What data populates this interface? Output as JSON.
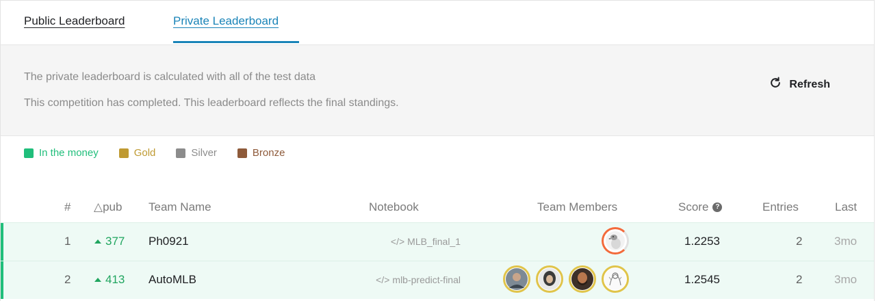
{
  "tabs": {
    "public_label": "Public Leaderboard",
    "private_label": "Private Leaderboard",
    "active": "Private Leaderboard"
  },
  "info": {
    "line1": "The private leaderboard is calculated with all of the test data",
    "line2": "This competition has completed. This leaderboard reflects the final standings.",
    "refresh_label": "Refresh"
  },
  "legend": {
    "items": [
      {
        "label": "In the money",
        "color": "#20be7b"
      },
      {
        "label": "Gold",
        "color": "#bf9a32"
      },
      {
        "label": "Silver",
        "color": "#8c8c8c"
      },
      {
        "label": "Bronze",
        "color": "#8e5a3a"
      }
    ]
  },
  "table": {
    "headers": {
      "rank": "#",
      "delta": "△pub",
      "team": "Team Name",
      "notebook": "Notebook",
      "members": "Team Members",
      "score": "Score",
      "entries": "Entries",
      "last": "Last"
    },
    "rows": [
      {
        "rank": "1",
        "delta": "377",
        "team": "Ph0921",
        "notebook": "MLB_final_1",
        "score": "1.2253",
        "entries": "2",
        "last": "3mo",
        "members": [
          "goose-avatar"
        ]
      },
      {
        "rank": "2",
        "delta": "413",
        "team": "AutoMLB",
        "notebook": "mlb-predict-final",
        "score": "1.2545",
        "entries": "2",
        "last": "3mo",
        "members": [
          "man-avatar",
          "hooded-avatar",
          "bearded-avatar",
          "sketch-avatar"
        ]
      }
    ]
  },
  "colors": {
    "accent": "#1a84b8",
    "money_green": "#20be7b",
    "gold_ring": "#e0c44a"
  }
}
